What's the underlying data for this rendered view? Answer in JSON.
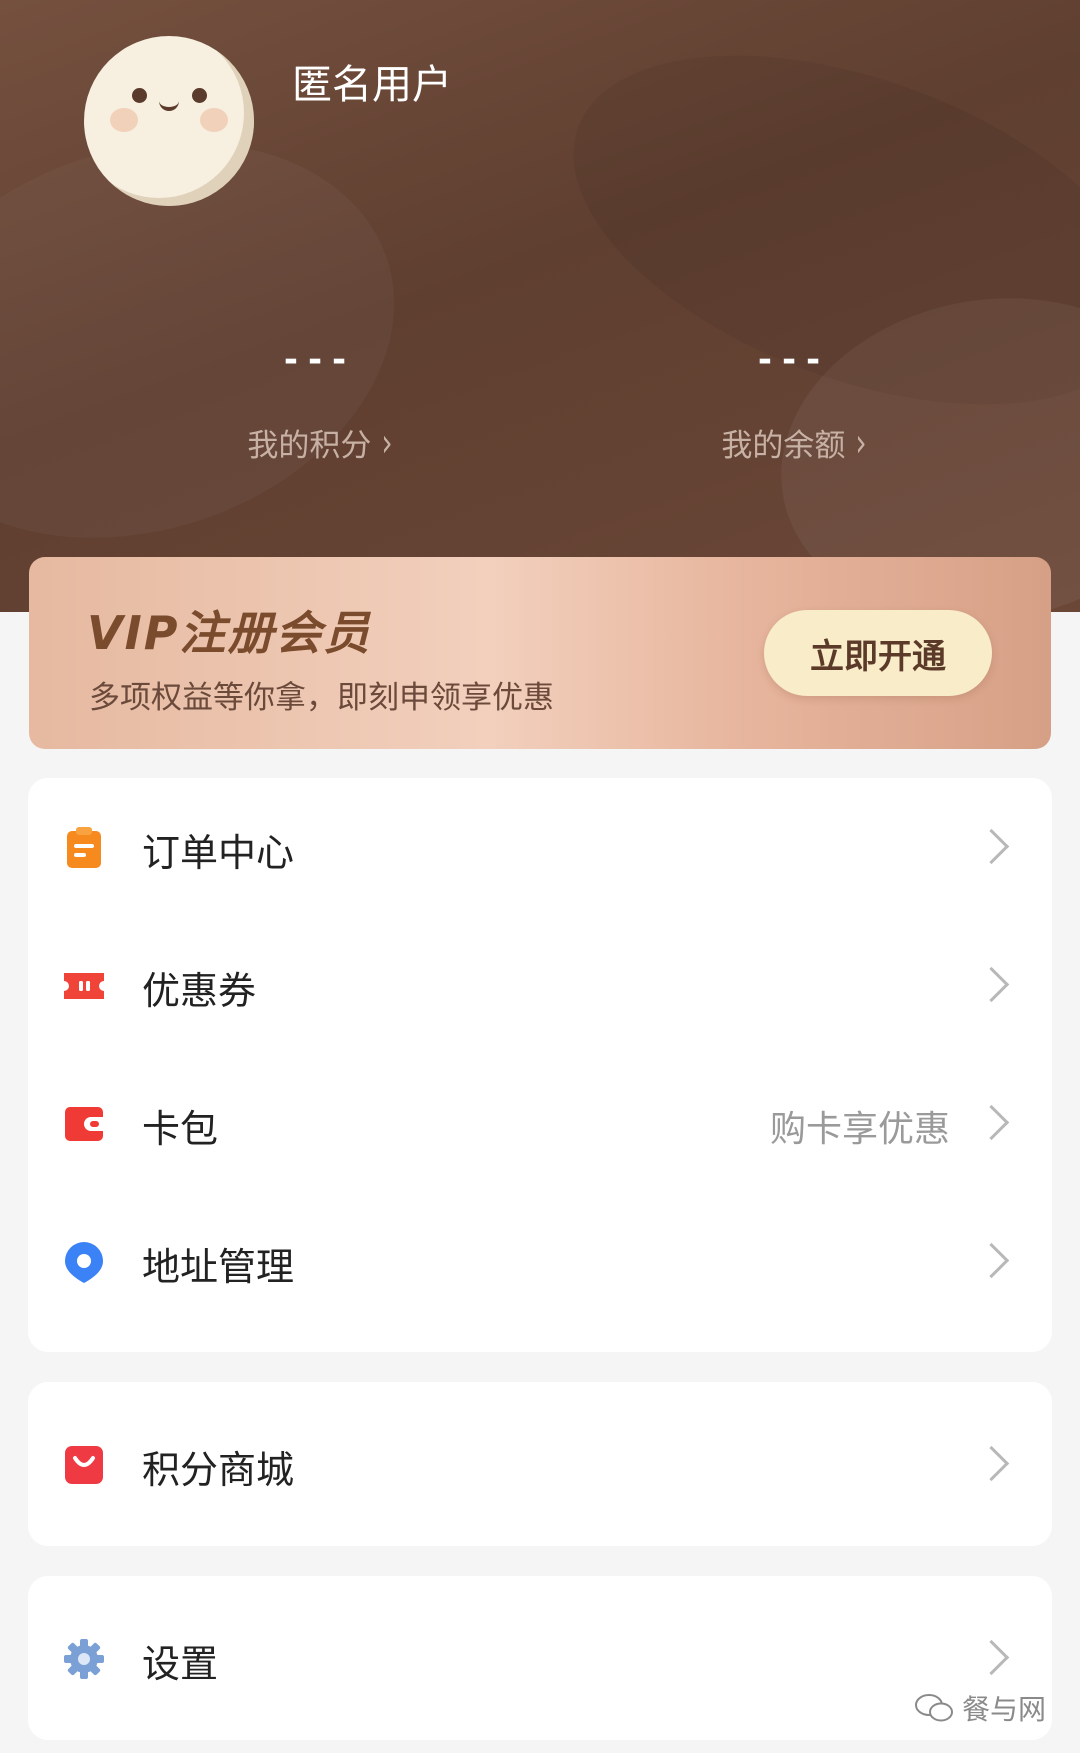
{
  "profile": {
    "username": "匿名用户",
    "points_value": "---",
    "points_label": "我的积分",
    "balance_value": "---",
    "balance_label": "我的余额"
  },
  "vip": {
    "title": "VIP注册会员",
    "subtitle": "多项权益等你拿，即刻申领享优惠",
    "button": "立即开通"
  },
  "menu": {
    "orders": "订单中心",
    "coupons": "优惠券",
    "card_pack": "卡包",
    "card_pack_hint": "购卡享优惠",
    "address": "地址管理",
    "points_mall": "积分商城",
    "settings": "设置"
  },
  "watermark": "餐与网",
  "colors": {
    "header_brown": "#6a4636",
    "vip_peach": "#ecc3ad",
    "vip_button": "#f8ecc9",
    "orders_icon": "#f68a1f",
    "coupon_icon": "#f04438",
    "card_icon": "#ef3a35",
    "address_icon": "#3b82f6",
    "mall_icon": "#ef3a43",
    "settings_icon": "#7ba0d6"
  }
}
